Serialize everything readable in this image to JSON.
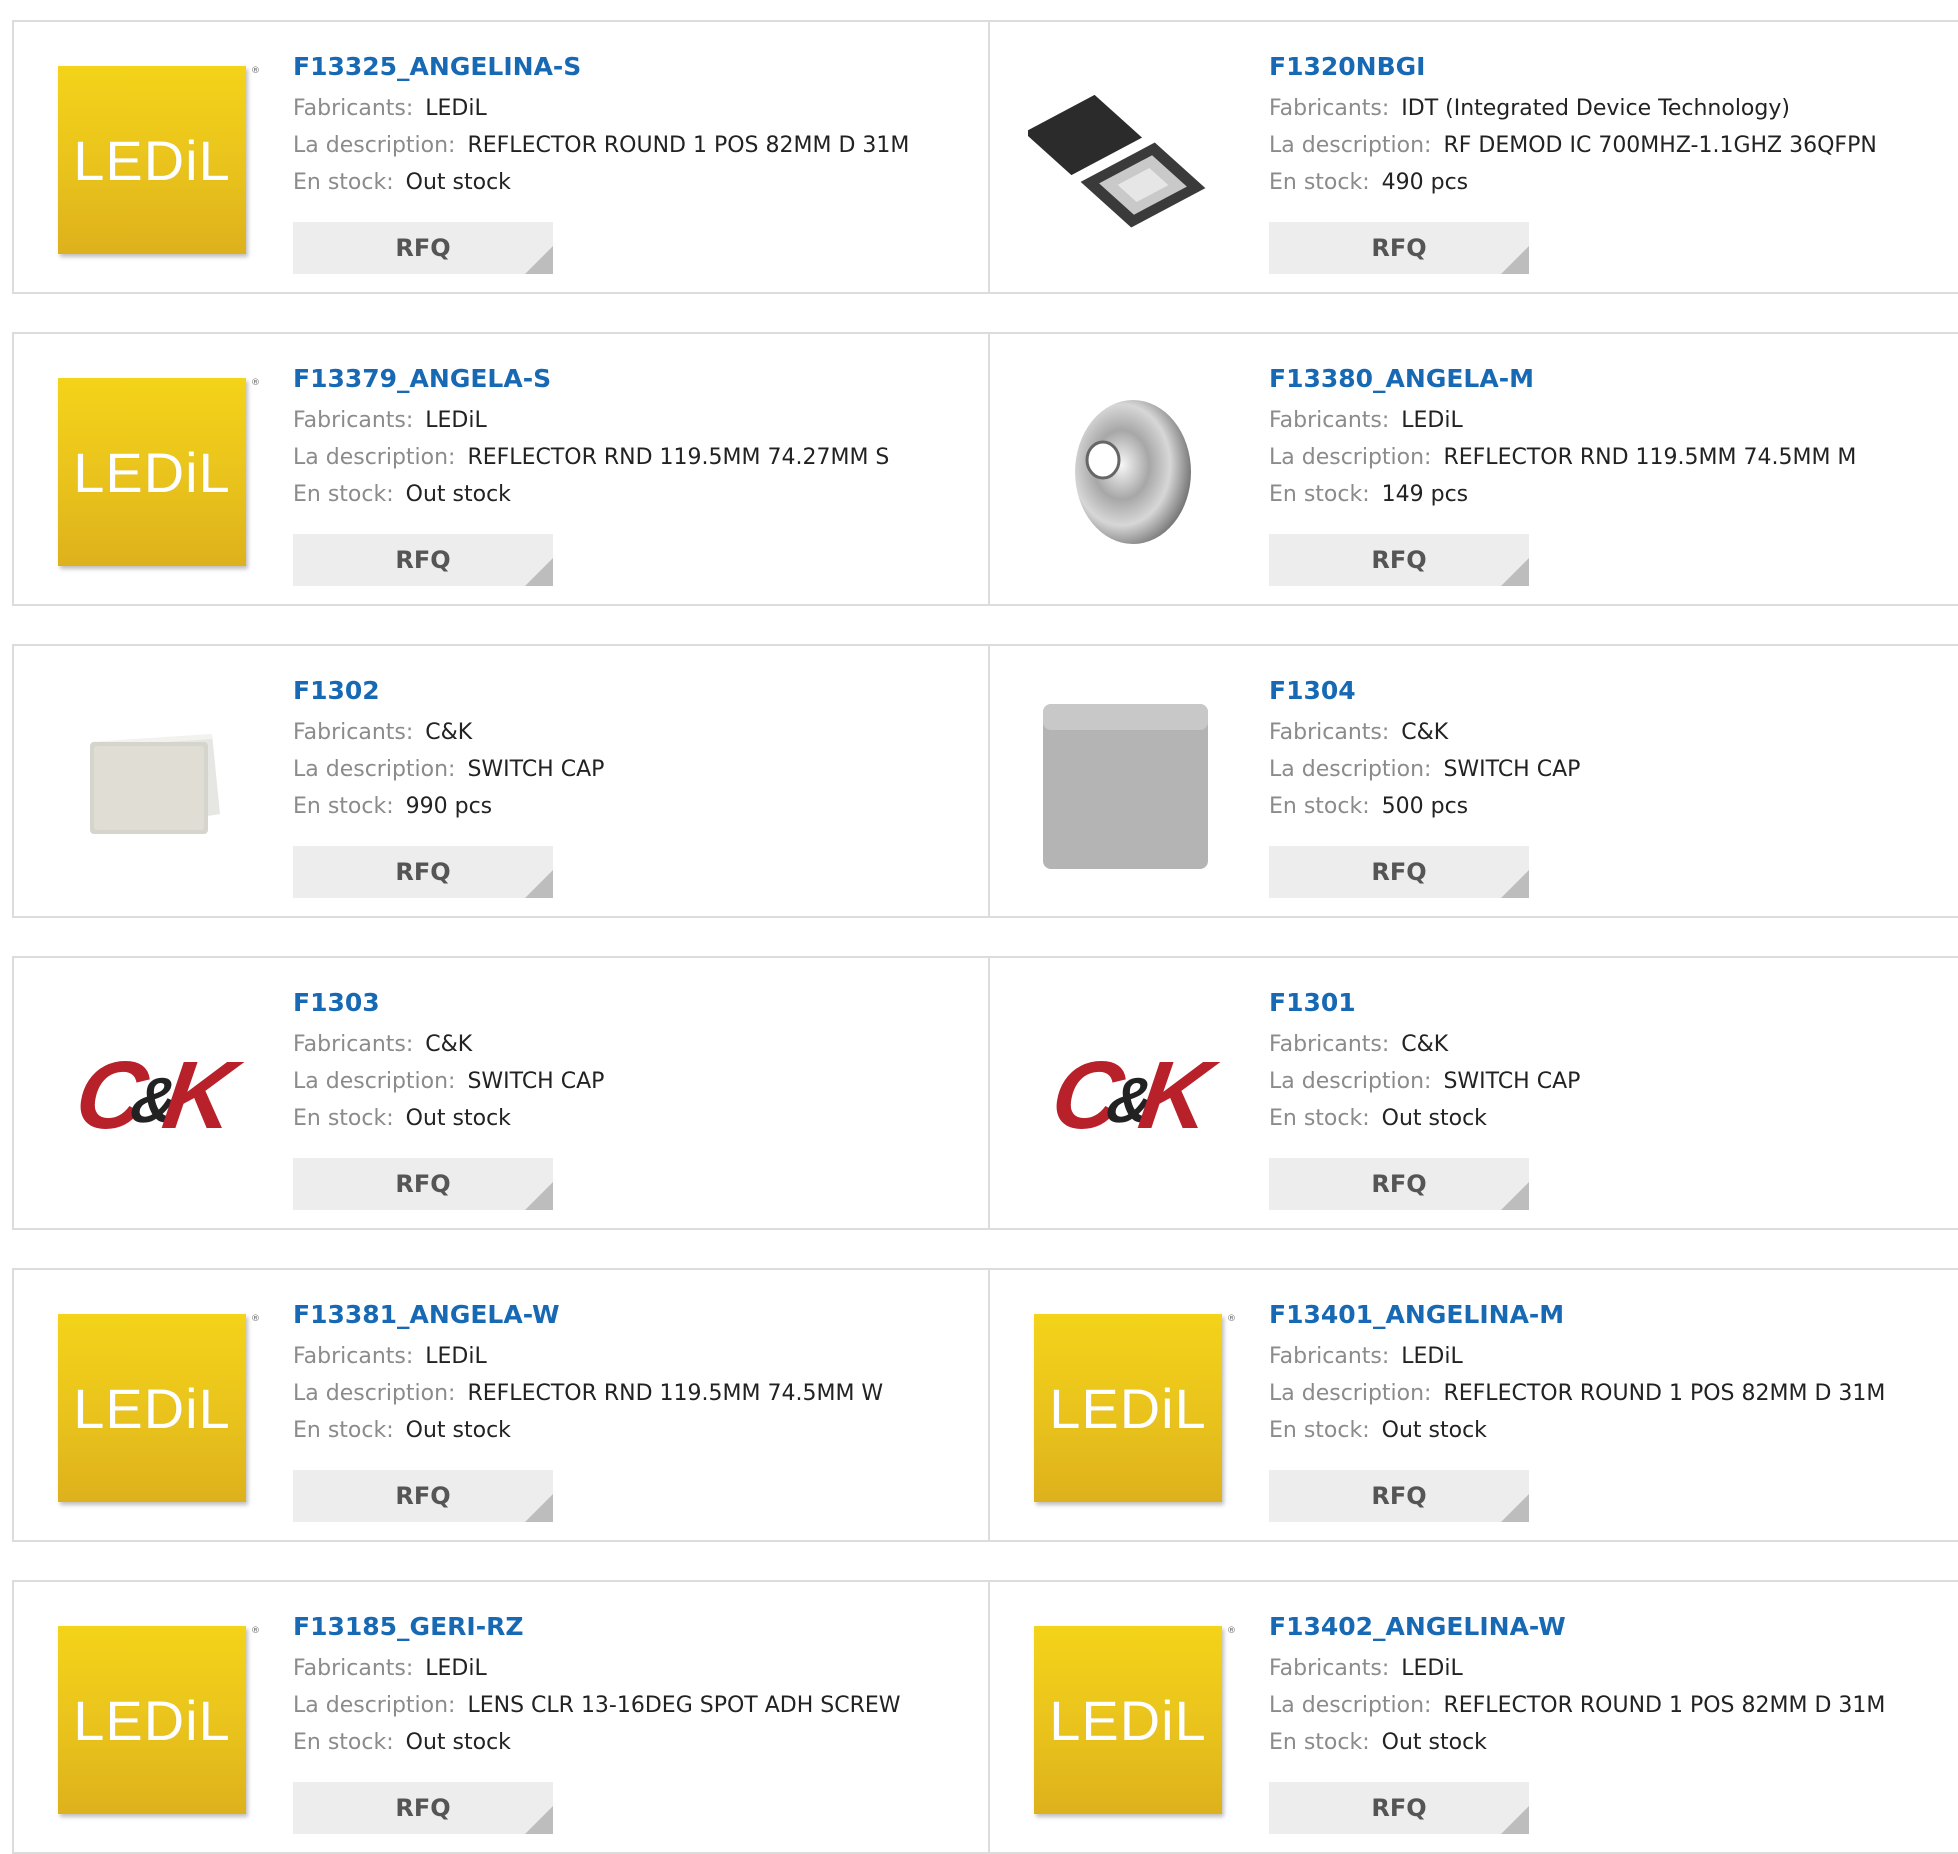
{
  "labels": {
    "manufacturer": "Fabricants:",
    "description": "La description:",
    "stock": "En stock:",
    "rfq": "RFQ"
  },
  "logos": {
    "ledil": "LEDiL",
    "ck": "C&K",
    "ck_c": "C",
    "ck_amp": "&",
    "ck_k": "K",
    "reg": "®"
  },
  "products": [
    {
      "part": "F13325_ANGELINA-S",
      "manufacturer": "LEDiL",
      "description": "REFLECTOR ROUND 1 POS 82MM D 31M",
      "stock": "Out stock",
      "image": "ledil-logo"
    },
    {
      "part": "F1320NBGI",
      "manufacturer": "IDT (Integrated Device Technology)",
      "description": "RF DEMOD IC 700MHZ-1.1GHZ 36QFPN",
      "stock": "490 pcs",
      "image": "qfn-chip"
    },
    {
      "part": "F13379_ANGELA-S",
      "manufacturer": "LEDiL",
      "description": "REFLECTOR RND 119.5MM 74.27MM S",
      "stock": "Out stock",
      "image": "ledil-logo"
    },
    {
      "part": "F13380_ANGELA-M",
      "manufacturer": "LEDiL",
      "description": "REFLECTOR RND 119.5MM 74.5MM M",
      "stock": "149 pcs",
      "image": "reflector"
    },
    {
      "part": "F1302",
      "manufacturer": "C&K",
      "description": "SWITCH CAP",
      "stock": "990 pcs",
      "image": "switch-cap-white"
    },
    {
      "part": "F1304",
      "manufacturer": "C&K",
      "description": "SWITCH CAP",
      "stock": "500 pcs",
      "image": "switch-cap-gray"
    },
    {
      "part": "F1303",
      "manufacturer": "C&K",
      "description": "SWITCH CAP",
      "stock": "Out stock",
      "image": "ck-logo"
    },
    {
      "part": "F1301",
      "manufacturer": "C&K",
      "description": "SWITCH CAP",
      "stock": "Out stock",
      "image": "ck-logo"
    },
    {
      "part": "F13381_ANGELA-W",
      "manufacturer": "LEDiL",
      "description": "REFLECTOR RND 119.5MM 74.5MM W",
      "stock": "Out stock",
      "image": "ledil-logo"
    },
    {
      "part": "F13401_ANGELINA-M",
      "manufacturer": "LEDiL",
      "description": "REFLECTOR ROUND 1 POS 82MM D 31M",
      "stock": "Out stock",
      "image": "ledil-logo"
    },
    {
      "part": "F13185_GERI-RZ",
      "manufacturer": "LEDiL",
      "description": "LENS CLR 13-16DEG SPOT ADH SCREW",
      "stock": "Out stock",
      "image": "ledil-logo"
    },
    {
      "part": "F13402_ANGELINA-W",
      "manufacturer": "LEDiL",
      "description": "REFLECTOR ROUND 1 POS 82MM D 31M",
      "stock": "Out stock",
      "image": "ledil-logo"
    }
  ],
  "colors": {
    "link": "#1869b4",
    "ledil_yellow": "#f4d31a",
    "ck_red": "#b8202a",
    "button_bg": "#ededed"
  }
}
